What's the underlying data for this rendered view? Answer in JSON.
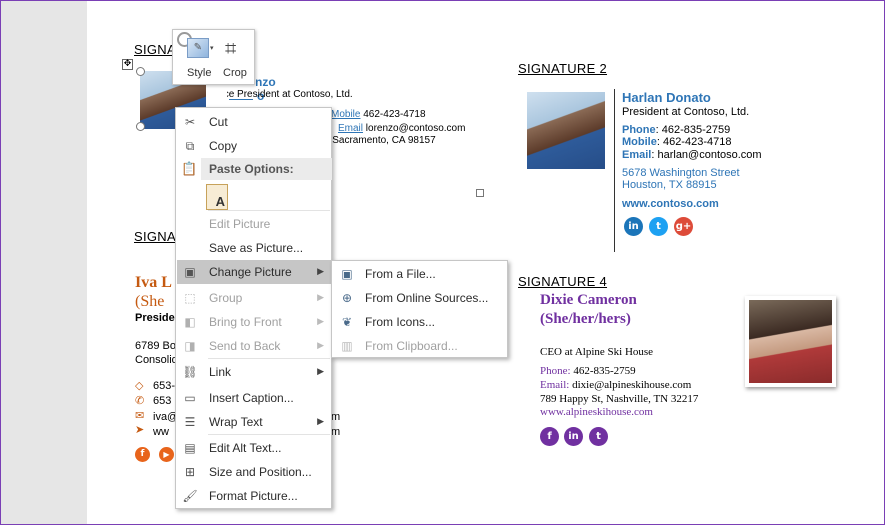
{
  "sig1": {
    "heading": "SIGNATURE 1",
    "name": "Lorenzo Rohro",
    "title": "Vice President at Contoso, Ltd.",
    "mobile_label": "Mobile",
    "mobile": "462-423-4718",
    "email_label": "Email",
    "email": "lorenzo@contoso.com",
    "address": "Street, Sacramento, CA 98157"
  },
  "sig2": {
    "heading": "SIGNATURE 2",
    "name": "Harlan Donato",
    "title": "President at Contoso, Ltd.",
    "phone_label": "Phone",
    "phone": ": 462-835-2759",
    "mobile_label": "Mobile",
    "mobile": ": 462-423-4718",
    "email_label": "Email",
    "email": ": harlan@contoso.com",
    "address1": "5678 Washington Street",
    "address2": "Houston, TX 88915",
    "website": "www.contoso.com",
    "socials": [
      {
        "icon": "linkedin-icon",
        "glyph": "in",
        "color": "#1b75b9"
      },
      {
        "icon": "twitter-icon",
        "glyph": "t",
        "color": "#1da1f2"
      },
      {
        "icon": "googleplus-icon",
        "glyph": "g+",
        "color": "#dd4b39"
      }
    ]
  },
  "sig3": {
    "heading": "SIGNATURE 3",
    "name": "Iva L",
    "pronoun": "(She",
    "title": "Preside",
    "address1": "6789 Bo",
    "address2": "Consolid",
    "phone1": "653-",
    "phone2": "653",
    "email": "iva@",
    "website": "ww",
    "website_tail": "m",
    "email_tail": "m"
  },
  "sig4": {
    "heading": "SIGNATURE 4",
    "name": "Dixie Cameron",
    "pronoun": "(She/her/hers)",
    "title": "CEO at Alpine Ski House",
    "phone_label": "Phone:",
    "phone": " 462-835-2759",
    "email_label": "Email:",
    "email": " dixie@alpineskihouse.com",
    "address": "789 Happy St, Nashville, TN 32217",
    "website": "www.alpineskihouse.com"
  },
  "mini_toolbar": {
    "style_label": "Style",
    "crop_label": "Crop"
  },
  "context_menu": {
    "cut": "Cut",
    "copy": "Copy",
    "paste_options": "Paste Options:",
    "edit_picture": "Edit Picture",
    "save_as_picture": "Save as Picture...",
    "change_picture": "Change Picture",
    "group": "Group",
    "bring_to_front": "Bring to Front",
    "send_to_back": "Send to Back",
    "link": "Link",
    "insert_caption": "Insert Caption...",
    "wrap_text": "Wrap Text",
    "edit_alt_text": "Edit Alt Text...",
    "size_and_position": "Size and Position...",
    "format_picture": "Format Picture..."
  },
  "submenu": {
    "from_file": "From a File...",
    "from_online": "From Online Sources...",
    "from_icons": "From Icons...",
    "from_clipboard": "From Clipboard..."
  },
  "colors": {
    "accent_orange": "#c55a11",
    "accent_purple": "#7030a0",
    "accent_blue": "#2e75b6",
    "menu_highlight": "#c6c6c6"
  }
}
